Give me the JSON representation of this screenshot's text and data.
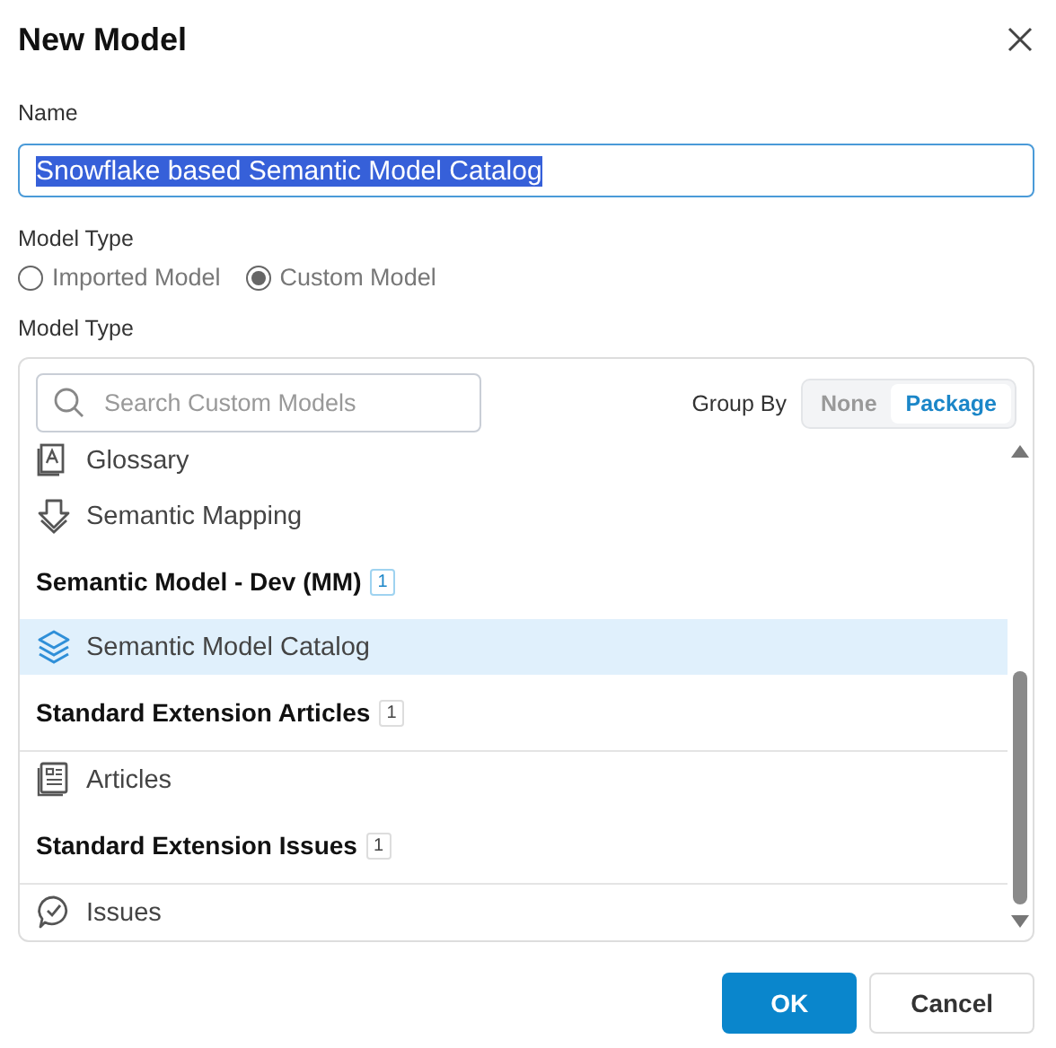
{
  "dialog": {
    "title": "New Model"
  },
  "name_field": {
    "label": "Name",
    "value": "Snowflake based Semantic Model Catalog",
    "selected_text": true
  },
  "model_type": {
    "label": "Model Type",
    "options": [
      {
        "label": "Imported Model",
        "selected": false
      },
      {
        "label": "Custom Model",
        "selected": true
      }
    ]
  },
  "model_list": {
    "label": "Model Type",
    "search": {
      "placeholder": "Search Custom Models"
    },
    "group_by": {
      "label": "Group By",
      "options": [
        {
          "label": "None",
          "selected": false
        },
        {
          "label": "Package",
          "selected": true
        }
      ]
    },
    "rows": [
      {
        "kind": "item",
        "label": "Glossary",
        "selected": false
      },
      {
        "kind": "item",
        "label": "Semantic Mapping",
        "selected": false
      },
      {
        "kind": "group",
        "label": "Semantic Model - Dev (MM)",
        "count": "1",
        "active": true
      },
      {
        "kind": "item",
        "label": "Semantic Model Catalog",
        "selected": true
      },
      {
        "kind": "group",
        "label": "Standard Extension Articles",
        "count": "1",
        "active": false
      },
      {
        "kind": "item",
        "label": "Articles",
        "selected": false
      },
      {
        "kind": "group",
        "label": "Standard Extension Issues",
        "count": "1",
        "active": false
      },
      {
        "kind": "item",
        "label": "Issues",
        "selected": false
      }
    ]
  },
  "buttons": [
    {
      "label": "OK",
      "kind": "primary"
    },
    {
      "label": "Cancel",
      "kind": "secondary"
    }
  ]
}
